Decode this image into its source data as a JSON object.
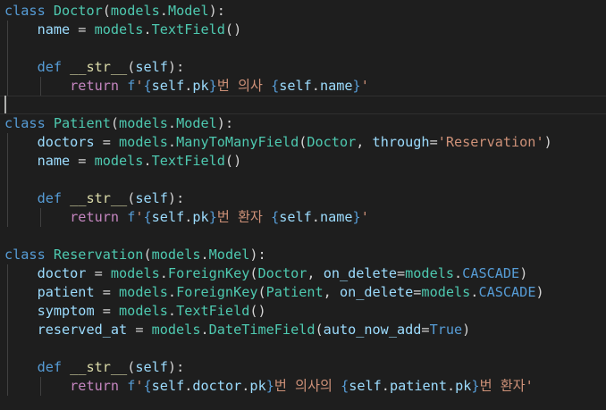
{
  "editor": {
    "language": "python",
    "theme": "dark",
    "colors": {
      "background": "#1e1e1e",
      "keyword": "#569cd6",
      "control": "#c586c0",
      "class": "#4ec9b0",
      "function": "#dcdcaa",
      "variable": "#9cdcfe",
      "string": "#ce9178",
      "text": "#d4d4d4"
    },
    "lines": [
      {
        "tokens": [
          {
            "t": "class",
            "c": "kw"
          },
          {
            "t": " "
          },
          {
            "t": "Doctor",
            "c": "cls"
          },
          {
            "t": "(",
            "c": "paren"
          },
          {
            "t": "models",
            "c": "cls"
          },
          {
            "t": ".",
            "c": "op"
          },
          {
            "t": "Model",
            "c": "cls"
          },
          {
            "t": "):",
            "c": "paren"
          }
        ]
      },
      {
        "tokens": [
          {
            "t": "    "
          },
          {
            "t": "name",
            "c": "var"
          },
          {
            "t": " = ",
            "c": "op"
          },
          {
            "t": "models",
            "c": "cls"
          },
          {
            "t": ".",
            "c": "op"
          },
          {
            "t": "TextField",
            "c": "cls"
          },
          {
            "t": "()",
            "c": "paren"
          }
        ]
      },
      {
        "tokens": []
      },
      {
        "tokens": [
          {
            "t": "    "
          },
          {
            "t": "def",
            "c": "kw"
          },
          {
            "t": " "
          },
          {
            "t": "__str__",
            "c": "fn"
          },
          {
            "t": "(",
            "c": "paren"
          },
          {
            "t": "self",
            "c": "var"
          },
          {
            "t": "):",
            "c": "paren"
          }
        ]
      },
      {
        "tokens": [
          {
            "t": "        "
          },
          {
            "t": "return",
            "c": "ctl"
          },
          {
            "t": " "
          },
          {
            "t": "f",
            "c": "kw"
          },
          {
            "t": "'",
            "c": "str"
          },
          {
            "t": "{",
            "c": "brace"
          },
          {
            "t": "self",
            "c": "var"
          },
          {
            "t": ".",
            "c": "op"
          },
          {
            "t": "pk",
            "c": "var"
          },
          {
            "t": "}",
            "c": "brace"
          },
          {
            "t": "번 의사 ",
            "c": "str"
          },
          {
            "t": "{",
            "c": "brace"
          },
          {
            "t": "self",
            "c": "var"
          },
          {
            "t": ".",
            "c": "op"
          },
          {
            "t": "name",
            "c": "var"
          },
          {
            "t": "}",
            "c": "brace"
          },
          {
            "t": "'",
            "c": "str"
          }
        ]
      },
      {
        "tokens": [],
        "cursor": true
      },
      {
        "tokens": [
          {
            "t": "class",
            "c": "kw"
          },
          {
            "t": " "
          },
          {
            "t": "Patient",
            "c": "cls"
          },
          {
            "t": "(",
            "c": "paren"
          },
          {
            "t": "models",
            "c": "cls"
          },
          {
            "t": ".",
            "c": "op"
          },
          {
            "t": "Model",
            "c": "cls"
          },
          {
            "t": "):",
            "c": "paren"
          }
        ]
      },
      {
        "tokens": [
          {
            "t": "    "
          },
          {
            "t": "doctors",
            "c": "var"
          },
          {
            "t": " = ",
            "c": "op"
          },
          {
            "t": "models",
            "c": "cls"
          },
          {
            "t": ".",
            "c": "op"
          },
          {
            "t": "ManyToManyField",
            "c": "cls"
          },
          {
            "t": "(",
            "c": "paren"
          },
          {
            "t": "Doctor",
            "c": "cls"
          },
          {
            "t": ", ",
            "c": "op"
          },
          {
            "t": "through",
            "c": "var"
          },
          {
            "t": "=",
            "c": "op"
          },
          {
            "t": "'Reservation'",
            "c": "str"
          },
          {
            "t": ")",
            "c": "paren"
          }
        ]
      },
      {
        "tokens": [
          {
            "t": "    "
          },
          {
            "t": "name",
            "c": "var"
          },
          {
            "t": " = ",
            "c": "op"
          },
          {
            "t": "models",
            "c": "cls"
          },
          {
            "t": ".",
            "c": "op"
          },
          {
            "t": "TextField",
            "c": "cls"
          },
          {
            "t": "()",
            "c": "paren"
          }
        ]
      },
      {
        "tokens": []
      },
      {
        "tokens": [
          {
            "t": "    "
          },
          {
            "t": "def",
            "c": "kw"
          },
          {
            "t": " "
          },
          {
            "t": "__str__",
            "c": "fn"
          },
          {
            "t": "(",
            "c": "paren"
          },
          {
            "t": "self",
            "c": "var"
          },
          {
            "t": "):",
            "c": "paren"
          }
        ]
      },
      {
        "tokens": [
          {
            "t": "        "
          },
          {
            "t": "return",
            "c": "ctl"
          },
          {
            "t": " "
          },
          {
            "t": "f",
            "c": "kw"
          },
          {
            "t": "'",
            "c": "str"
          },
          {
            "t": "{",
            "c": "brace"
          },
          {
            "t": "self",
            "c": "var"
          },
          {
            "t": ".",
            "c": "op"
          },
          {
            "t": "pk",
            "c": "var"
          },
          {
            "t": "}",
            "c": "brace"
          },
          {
            "t": "번 환자 ",
            "c": "str"
          },
          {
            "t": "{",
            "c": "brace"
          },
          {
            "t": "self",
            "c": "var"
          },
          {
            "t": ".",
            "c": "op"
          },
          {
            "t": "name",
            "c": "var"
          },
          {
            "t": "}",
            "c": "brace"
          },
          {
            "t": "'",
            "c": "str"
          }
        ]
      },
      {
        "tokens": []
      },
      {
        "tokens": [
          {
            "t": "class",
            "c": "kw"
          },
          {
            "t": " "
          },
          {
            "t": "Reservation",
            "c": "cls"
          },
          {
            "t": "(",
            "c": "paren"
          },
          {
            "t": "models",
            "c": "cls"
          },
          {
            "t": ".",
            "c": "op"
          },
          {
            "t": "Model",
            "c": "cls"
          },
          {
            "t": "):",
            "c": "paren"
          }
        ]
      },
      {
        "tokens": [
          {
            "t": "    "
          },
          {
            "t": "doctor",
            "c": "var"
          },
          {
            "t": " = ",
            "c": "op"
          },
          {
            "t": "models",
            "c": "cls"
          },
          {
            "t": ".",
            "c": "op"
          },
          {
            "t": "ForeignKey",
            "c": "cls"
          },
          {
            "t": "(",
            "c": "paren"
          },
          {
            "t": "Doctor",
            "c": "cls"
          },
          {
            "t": ", ",
            "c": "op"
          },
          {
            "t": "on_delete",
            "c": "var"
          },
          {
            "t": "=",
            "c": "op"
          },
          {
            "t": "models",
            "c": "cls"
          },
          {
            "t": ".",
            "c": "op"
          },
          {
            "t": "CASCADE",
            "c": "const"
          },
          {
            "t": ")",
            "c": "paren"
          }
        ]
      },
      {
        "tokens": [
          {
            "t": "    "
          },
          {
            "t": "patient",
            "c": "var"
          },
          {
            "t": " = ",
            "c": "op"
          },
          {
            "t": "models",
            "c": "cls"
          },
          {
            "t": ".",
            "c": "op"
          },
          {
            "t": "ForeignKey",
            "c": "cls"
          },
          {
            "t": "(",
            "c": "paren"
          },
          {
            "t": "Patient",
            "c": "cls"
          },
          {
            "t": ", ",
            "c": "op"
          },
          {
            "t": "on_delete",
            "c": "var"
          },
          {
            "t": "=",
            "c": "op"
          },
          {
            "t": "models",
            "c": "cls"
          },
          {
            "t": ".",
            "c": "op"
          },
          {
            "t": "CASCADE",
            "c": "const"
          },
          {
            "t": ")",
            "c": "paren"
          }
        ]
      },
      {
        "tokens": [
          {
            "t": "    "
          },
          {
            "t": "symptom",
            "c": "var"
          },
          {
            "t": " = ",
            "c": "op"
          },
          {
            "t": "models",
            "c": "cls"
          },
          {
            "t": ".",
            "c": "op"
          },
          {
            "t": "TextField",
            "c": "cls"
          },
          {
            "t": "()",
            "c": "paren"
          }
        ]
      },
      {
        "tokens": [
          {
            "t": "    "
          },
          {
            "t": "reserved_at",
            "c": "var"
          },
          {
            "t": " = ",
            "c": "op"
          },
          {
            "t": "models",
            "c": "cls"
          },
          {
            "t": ".",
            "c": "op"
          },
          {
            "t": "DateTimeField",
            "c": "cls"
          },
          {
            "t": "(",
            "c": "paren"
          },
          {
            "t": "auto_now_add",
            "c": "var"
          },
          {
            "t": "=",
            "c": "op"
          },
          {
            "t": "True",
            "c": "const"
          },
          {
            "t": ")",
            "c": "paren"
          }
        ]
      },
      {
        "tokens": []
      },
      {
        "tokens": [
          {
            "t": "    "
          },
          {
            "t": "def",
            "c": "kw"
          },
          {
            "t": " "
          },
          {
            "t": "__str__",
            "c": "fn"
          },
          {
            "t": "(",
            "c": "paren"
          },
          {
            "t": "self",
            "c": "var"
          },
          {
            "t": "):",
            "c": "paren"
          }
        ]
      },
      {
        "tokens": [
          {
            "t": "        "
          },
          {
            "t": "return",
            "c": "ctl"
          },
          {
            "t": " "
          },
          {
            "t": "f",
            "c": "kw"
          },
          {
            "t": "'",
            "c": "str"
          },
          {
            "t": "{",
            "c": "brace"
          },
          {
            "t": "self",
            "c": "var"
          },
          {
            "t": ".",
            "c": "op"
          },
          {
            "t": "doctor",
            "c": "var"
          },
          {
            "t": ".",
            "c": "op"
          },
          {
            "t": "pk",
            "c": "var"
          },
          {
            "t": "}",
            "c": "brace"
          },
          {
            "t": "번 의사의 ",
            "c": "str"
          },
          {
            "t": "{",
            "c": "brace"
          },
          {
            "t": "self",
            "c": "var"
          },
          {
            "t": ".",
            "c": "op"
          },
          {
            "t": "patient",
            "c": "var"
          },
          {
            "t": ".",
            "c": "op"
          },
          {
            "t": "pk",
            "c": "var"
          },
          {
            "t": "}",
            "c": "brace"
          },
          {
            "t": "번 환자'",
            "c": "str"
          }
        ]
      }
    ]
  }
}
